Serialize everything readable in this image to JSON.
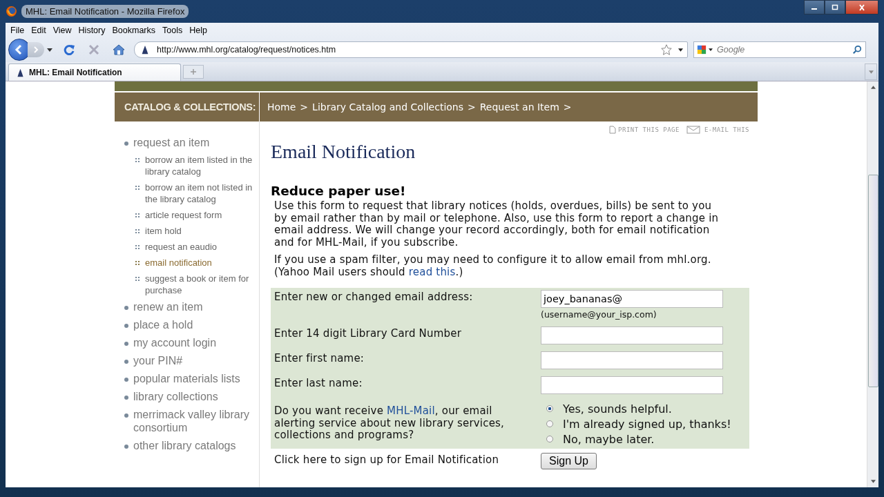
{
  "window": {
    "title": "MHL: Email Notification - Mozilla Firefox"
  },
  "menu": [
    "File",
    "Edit",
    "View",
    "History",
    "Bookmarks",
    "Tools",
    "Help"
  ],
  "toolbar": {
    "url": "http://www.mhl.org/catalog/request/notices.htm",
    "search_placeholder": "Google"
  },
  "tabs": [
    {
      "label": "MHL: Email Notification",
      "selected": true
    }
  ],
  "page": {
    "section_label": "CATALOG & COLLECTIONS:",
    "breadcrumb": [
      "Home",
      "Library Catalog and Collections",
      "Request an Item"
    ],
    "breadcrumb_separator": ">",
    "page_tools": [
      "PRINT THIS PAGE",
      "E-MAIL THIS"
    ],
    "sidebar": [
      {
        "label": "request an item",
        "selected": false,
        "children": [
          {
            "label": "borrow an item listed in the library catalog",
            "selected": false
          },
          {
            "label": "borrow an item not listed in the library catalog",
            "selected": false
          },
          {
            "label": "article request form",
            "selected": false
          },
          {
            "label": "item hold",
            "selected": false
          },
          {
            "label": "request an eaudio",
            "selected": false
          },
          {
            "label": "email notification",
            "selected": true
          },
          {
            "label": "suggest a book or item for purchase",
            "selected": false
          }
        ]
      },
      {
        "label": "renew an item",
        "selected": false
      },
      {
        "label": "place a hold",
        "selected": false
      },
      {
        "label": "my account login",
        "selected": false
      },
      {
        "label": "your PIN#",
        "selected": false
      },
      {
        "label": "popular materials lists",
        "selected": false
      },
      {
        "label": "library collections",
        "selected": false
      },
      {
        "label": "merrimack valley library consortium",
        "selected": false
      },
      {
        "label": "other library catalogs",
        "selected": false
      }
    ],
    "heading": "Email Notification",
    "subheading": "Reduce paper use!",
    "paragraphs": [
      [
        {
          "text": "Use this form to request that library notices (holds, overdues, bills) be sent to you by email rather than by mail or telephone. Also, use this form to report a change in email address. We will change your record accordingly, both for email notification and for MHL-Mail, if you subscribe."
        }
      ],
      [
        {
          "text": "If you use a spam filter, you may need to configure it to allow email from mhl.org. (Yahoo Mail users should "
        },
        {
          "text": "read this",
          "link": true
        },
        {
          "text": ".)"
        }
      ]
    ],
    "form": [
      {
        "kind": "text",
        "label": [
          {
            "text": "Enter new or changed email address:"
          }
        ],
        "value": "joey_bananas@",
        "hint": "(username@your_isp.com)"
      },
      {
        "kind": "text",
        "label": [
          {
            "text": "Enter 14 digit Library Card Number"
          }
        ]
      },
      {
        "kind": "text",
        "label": [
          {
            "text": "Enter first name:"
          }
        ]
      },
      {
        "kind": "text",
        "label": [
          {
            "text": "Enter last name:"
          }
        ]
      },
      {
        "kind": "radio",
        "label": [
          {
            "text": "Do you want receive "
          },
          {
            "text": "MHL-Mail",
            "link": true
          },
          {
            "text": ", our email alerting service about new library services, collections and programs?"
          }
        ],
        "options": [
          {
            "label": "Yes, sounds helpful.",
            "selected": true
          },
          {
            "label": "I'm already signed up, thanks!",
            "selected": false
          },
          {
            "label": "No, maybe later.",
            "selected": false
          }
        ]
      },
      {
        "kind": "button",
        "label": [
          {
            "text": "Click here to sign up for Email Notification"
          }
        ],
        "button": "Sign Up"
      }
    ]
  }
}
